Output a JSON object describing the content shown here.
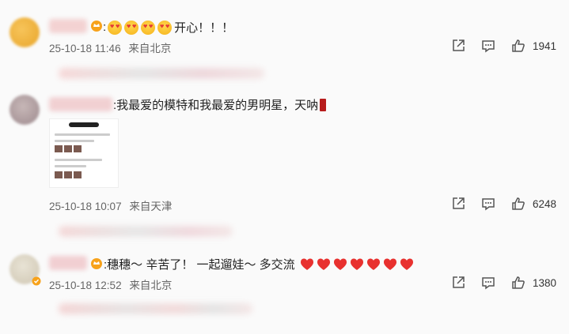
{
  "comments": [
    {
      "text": ":",
      "text_tail": "开心！！！",
      "time": "25-10-18 11:46",
      "location": "来自北京",
      "likes": "1941"
    },
    {
      "text": ":我最爱的模特和我最爱的男明星，天呐",
      "time": "25-10-18 10:07",
      "location": "来自天津",
      "likes": "6248"
    },
    {
      "text": ":穗穗～ 辛苦了！  一起遛娃～  多交流",
      "time": "25-10-18 12:52",
      "location": "来自北京",
      "likes": "1380"
    }
  ],
  "icons": {
    "share": "share-icon",
    "comment": "comment-icon",
    "like": "like-icon"
  },
  "colors": {
    "heart": "#e8312f",
    "badge": "#f7a21b",
    "meta": "#666666"
  }
}
